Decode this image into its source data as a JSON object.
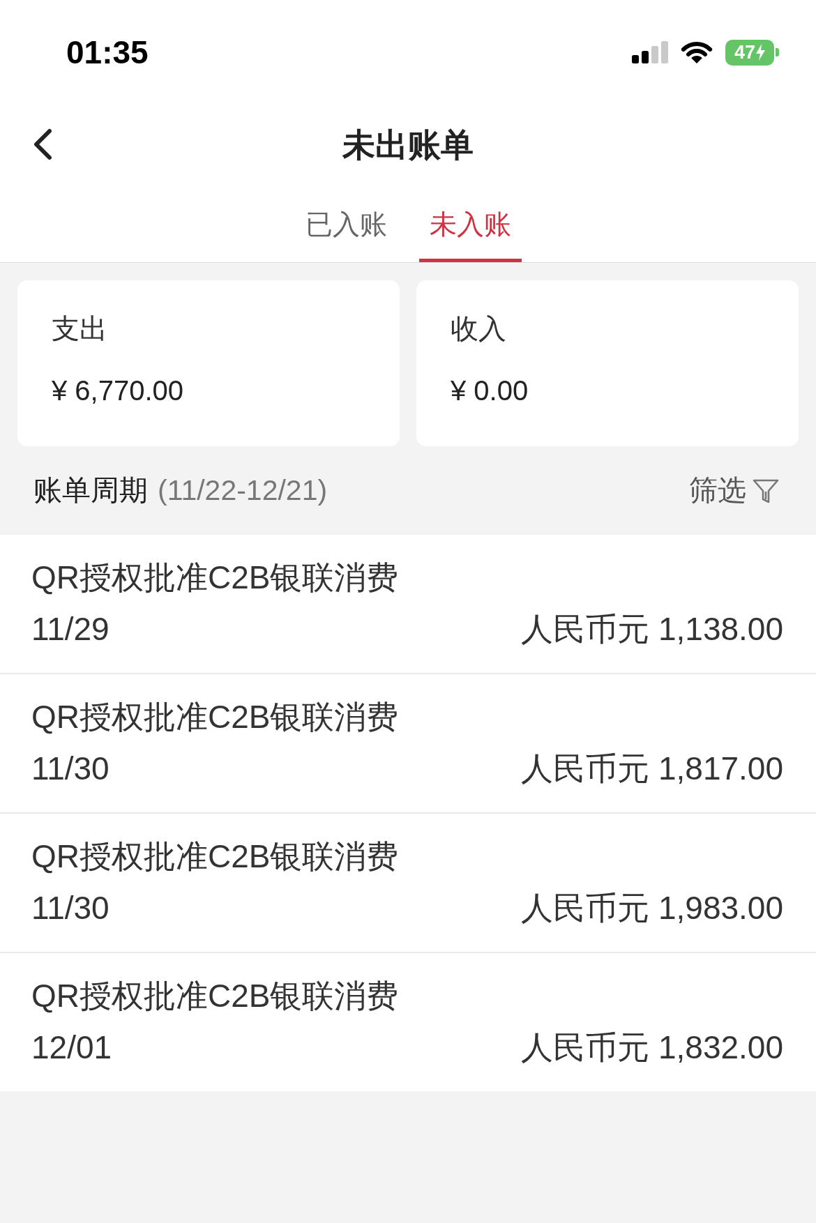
{
  "status_bar": {
    "time": "01:35",
    "battery": "47",
    "charging": true
  },
  "nav": {
    "title": "未出账单"
  },
  "tabs": [
    {
      "label": "已入账",
      "selected": false
    },
    {
      "label": "未入账",
      "selected": true
    }
  ],
  "summary": [
    {
      "label": "支出",
      "amount": "¥ 6,770.00"
    },
    {
      "label": "收入",
      "amount": "¥ 0.00"
    }
  ],
  "period": {
    "label": "账单周期",
    "range": "(11/22-12/21)"
  },
  "filter": {
    "label": "筛选"
  },
  "transactions": [
    {
      "description": "QR授权批准C2B银联消费",
      "date": "11/29",
      "amount": "人民币元 1,138.00"
    },
    {
      "description": "QR授权批准C2B银联消费",
      "date": "11/30",
      "amount": "人民币元 1,817.00"
    },
    {
      "description": "QR授权批准C2B银联消费",
      "date": "11/30",
      "amount": "人民币元 1,983.00"
    },
    {
      "description": "QR授权批准C2B银联消费",
      "date": "12/01",
      "amount": "人民币元 1,832.00"
    }
  ]
}
